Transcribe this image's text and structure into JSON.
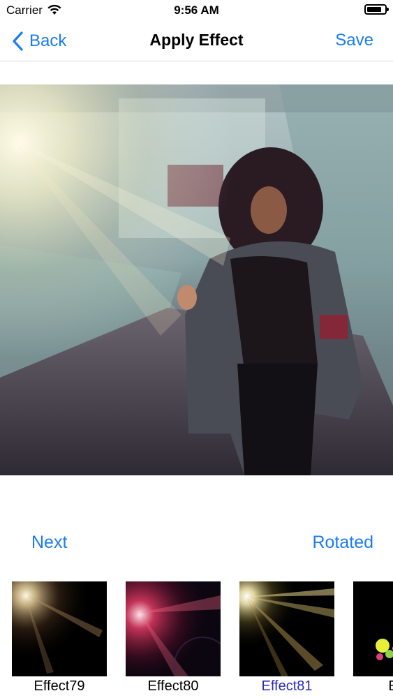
{
  "status_bar": {
    "carrier": "Carrier",
    "time": "9:56 AM"
  },
  "nav": {
    "back_label": "Back",
    "title": "Apply Effect",
    "save_label": "Save"
  },
  "actions": {
    "next_label": "Next",
    "rotated_label": "Rotated"
  },
  "effects": [
    {
      "label": "Effect79",
      "selected": false
    },
    {
      "label": "Effect80",
      "selected": false
    },
    {
      "label": "Effect81",
      "selected": true
    },
    {
      "label": "Effe",
      "selected": false
    }
  ],
  "colors": {
    "accent": "#1a7cf0",
    "selected_label": "#2b2bb8"
  },
  "icons": {
    "back": "chevron-left-icon",
    "wifi": "wifi-icon",
    "battery": "battery-icon"
  }
}
